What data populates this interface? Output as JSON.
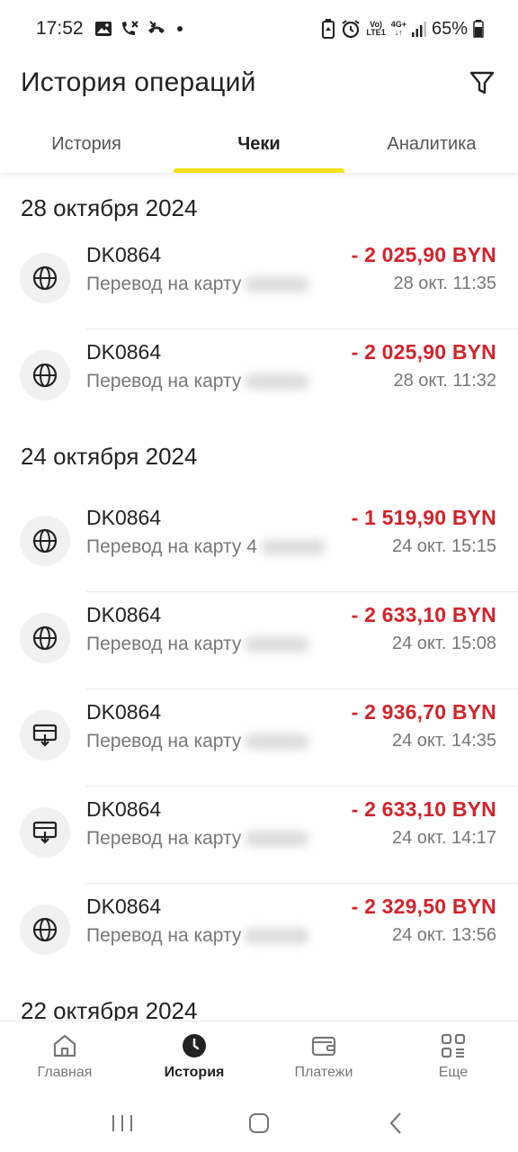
{
  "status_bar": {
    "time": "17:52",
    "network_top": "Vo)",
    "network_bottom": "LTE1",
    "data_top": "4G+",
    "battery": "65%"
  },
  "header": {
    "title": "История операций"
  },
  "tabs": [
    {
      "label": "История",
      "active": false
    },
    {
      "label": "Чеки",
      "active": true
    },
    {
      "label": "Аналитика",
      "active": false
    }
  ],
  "groups": [
    {
      "date": "28 октября 2024",
      "operations": [
        {
          "title": "DK0864",
          "description": "Перевод на карту",
          "amount": "- 2 025,90 BYN",
          "time": "28 окт. 11:35",
          "icon": "globe-icon"
        },
        {
          "title": "DK0864",
          "description": "Перевод на карту",
          "amount": "- 2 025,90 BYN",
          "time": "28 окт. 11:32",
          "icon": "globe-icon"
        }
      ]
    },
    {
      "date": "24 октября 2024",
      "operations": [
        {
          "title": "DK0864",
          "description": "Перевод на карту 4",
          "amount": "- 1 519,90 BYN",
          "time": "24 окт. 15:15",
          "icon": "globe-icon"
        },
        {
          "title": "DK0864",
          "description": "Перевод на карту",
          "amount": "- 2 633,10 BYN",
          "time": "24 окт. 15:08",
          "icon": "globe-icon"
        },
        {
          "title": "DK0864",
          "description": "Перевод на карту",
          "amount": "- 2 936,70 BYN",
          "time": "24 окт. 14:35",
          "icon": "withdraw-icon"
        },
        {
          "title": "DK0864",
          "description": "Перевод на карту",
          "amount": "- 2 633,10 BYN",
          "time": "24 окт. 14:17",
          "icon": "withdraw-icon"
        },
        {
          "title": "DK0864",
          "description": "Перевод на карту",
          "amount": "- 2 329,50 BYN",
          "time": "24 окт. 13:56",
          "icon": "globe-icon"
        }
      ]
    },
    {
      "date": "22 октября 2024",
      "operations": []
    }
  ],
  "bottom_nav": [
    {
      "label": "Главная",
      "icon": "home-icon",
      "active": false
    },
    {
      "label": "История",
      "icon": "clock-icon",
      "active": true
    },
    {
      "label": "Платежи",
      "icon": "wallet-icon",
      "active": false
    },
    {
      "label": "Еще",
      "icon": "grid-icon",
      "active": false
    }
  ],
  "colors": {
    "accent": "#f5e21a",
    "amount_negative": "#d3232a"
  }
}
